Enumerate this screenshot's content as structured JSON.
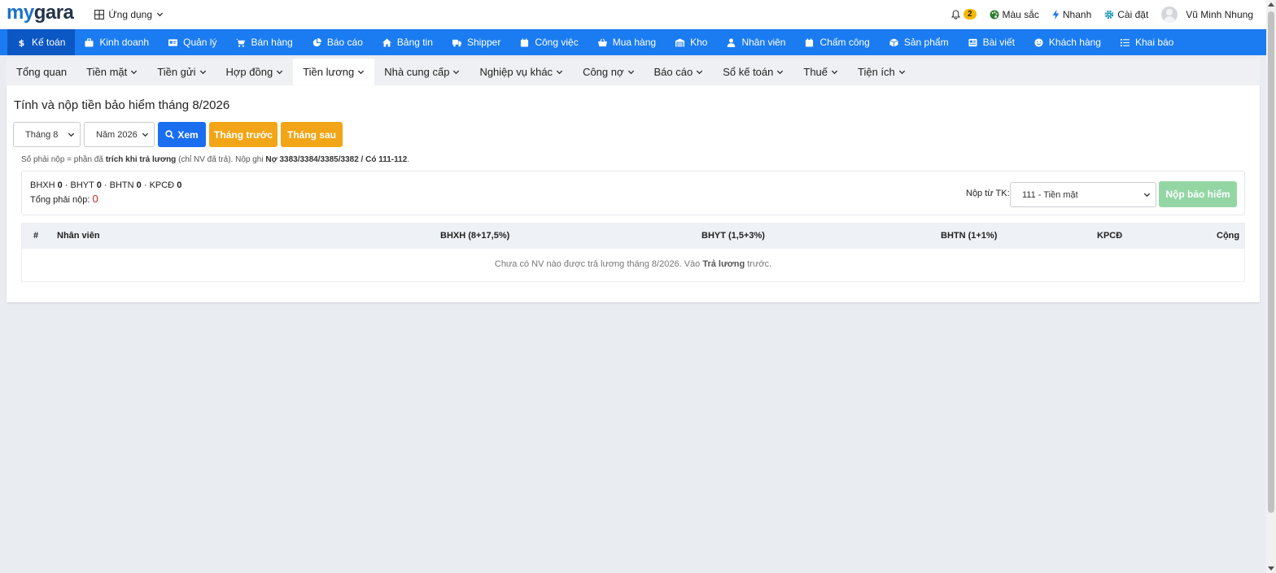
{
  "brand": {
    "my": "my",
    "gara": "gara"
  },
  "header": {
    "apps_label": "Ứng dụng",
    "notifications_count": "2",
    "colors_label": "Màu sắc",
    "quick_label": "Nhanh",
    "settings_label": "Cài đặt",
    "user_name": "Vũ Minh Nhung"
  },
  "main_nav": [
    {
      "label": "Kế toán",
      "icon": "dollar-icon"
    },
    {
      "label": "Kinh doanh",
      "icon": "briefcase-icon"
    },
    {
      "label": "Quản lý",
      "icon": "id-card-icon"
    },
    {
      "label": "Bán hàng",
      "icon": "cart-icon"
    },
    {
      "label": "Báo cáo",
      "icon": "pie-chart-icon"
    },
    {
      "label": "Bảng tin",
      "icon": "home-icon"
    },
    {
      "label": "Shipper",
      "icon": "truck-icon"
    },
    {
      "label": "Công việc",
      "icon": "calendar-icon"
    },
    {
      "label": "Mua hàng",
      "icon": "basket-icon"
    },
    {
      "label": "Kho",
      "icon": "warehouse-icon"
    },
    {
      "label": "Nhân viên",
      "icon": "user-icon"
    },
    {
      "label": "Chấm công",
      "icon": "calendar-check-icon"
    },
    {
      "label": "Sản phẩm",
      "icon": "box-icon"
    },
    {
      "label": "Bài viết",
      "icon": "newspaper-icon"
    },
    {
      "label": "Khách hàng",
      "icon": "smile-icon"
    },
    {
      "label": "Khai báo",
      "icon": "list-icon"
    }
  ],
  "sub_nav": [
    {
      "label": "Tổng quan",
      "dropdown": false
    },
    {
      "label": "Tiền mặt",
      "dropdown": true
    },
    {
      "label": "Tiền gửi",
      "dropdown": true
    },
    {
      "label": "Hợp đồng",
      "dropdown": true
    },
    {
      "label": "Tiền lương",
      "dropdown": true
    },
    {
      "label": "Nhà cung cấp",
      "dropdown": true
    },
    {
      "label": "Nghiệp vụ khác",
      "dropdown": true
    },
    {
      "label": "Công nợ",
      "dropdown": true
    },
    {
      "label": "Báo cáo",
      "dropdown": true
    },
    {
      "label": "Sổ kế toán",
      "dropdown": true
    },
    {
      "label": "Thuế",
      "dropdown": true
    },
    {
      "label": "Tiện ích",
      "dropdown": true
    }
  ],
  "page": {
    "title": "Tính và nộp tiền bảo hiểm tháng 8/2026",
    "month_select": "Tháng 8",
    "year_select": "Năm 2026",
    "view_button": "Xem",
    "prev_button": "Tháng trước",
    "next_button": "Tháng sau",
    "note": {
      "p1": "Số phải nộp = phần đã ",
      "b1": "trích khi trả lương",
      "p2": " (chỉ NV đã trả). Nộp ghi ",
      "b2": "Nợ 3383/3384/3385/3382 / Có 111-112",
      "p3": "."
    },
    "summary": {
      "bhxh_label": "BHXH",
      "bhxh_value": "0",
      "bhyt_label": "BHYT",
      "bhyt_value": "0",
      "bhtn_label": "BHTN",
      "bhtn_value": "0",
      "kpcd_label": "KPCĐ",
      "kpcd_value": "0",
      "total_label": "Tổng phải nộp:",
      "total_value": "0",
      "pay_from_label": "Nộp từ TK:",
      "pay_from_value": "111 - Tiền mặt",
      "pay_button": "Nộp bảo hiểm"
    },
    "table": {
      "columns": [
        "#",
        "Nhân viên",
        "BHXH (8+17,5%)",
        "BHYT (1,5+3%)",
        "BHTN (1+1%)",
        "KPCĐ",
        "Cộng"
      ],
      "empty": {
        "p1": "Chưa có NV nào được trả lương tháng 8/2026. Vào ",
        "b1": "Trả lương",
        "p2": " trước."
      }
    }
  },
  "colors": {
    "brand_blue": "#1a7cf0",
    "active_blue": "#0b57c4",
    "orange": "#f2a516",
    "green_disabled": "#93d6a4",
    "red_total": "#c62828"
  }
}
